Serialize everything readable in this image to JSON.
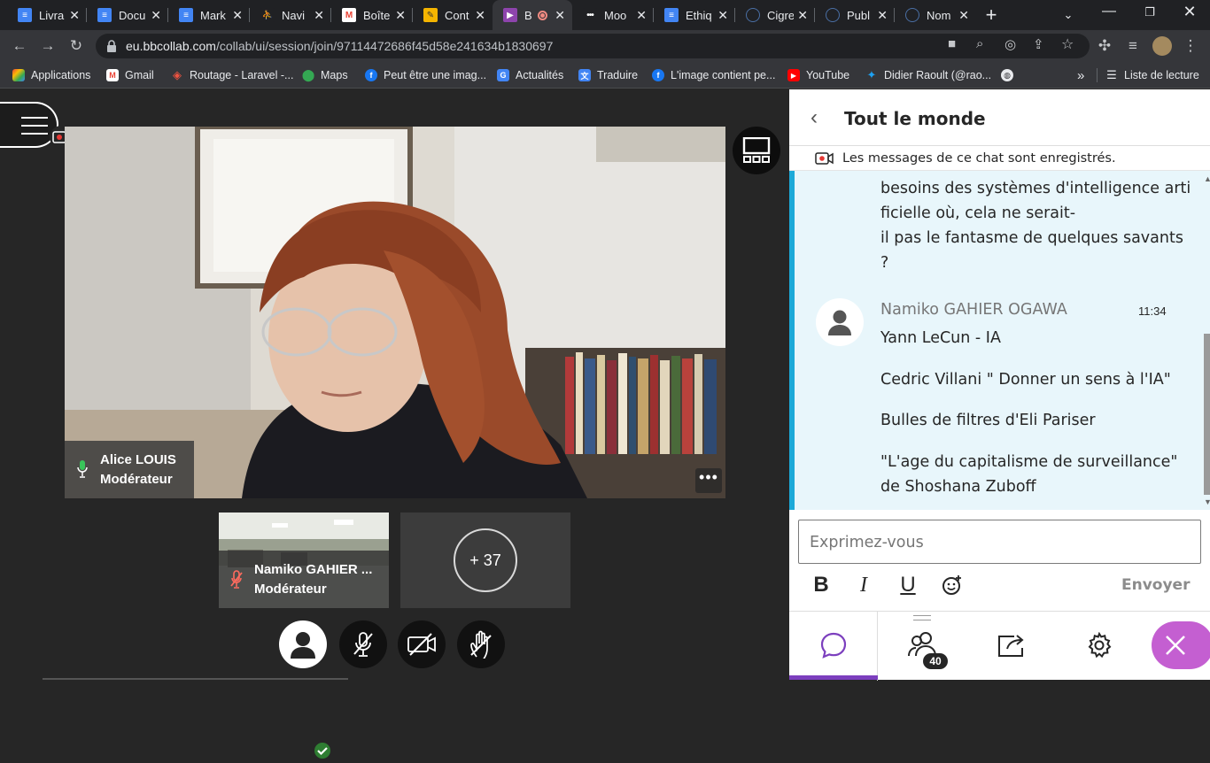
{
  "browser": {
    "tabs": [
      {
        "title": "Livra",
        "icon": "docs-icon"
      },
      {
        "title": "Docu",
        "icon": "docs-icon"
      },
      {
        "title": "Mark",
        "icon": "docs-icon"
      },
      {
        "title": "Navi",
        "icon": "figure-icon"
      },
      {
        "title": "Boîte",
        "icon": "gmail-icon"
      },
      {
        "title": "Cont",
        "icon": "contents-icon"
      },
      {
        "title": "B",
        "icon": "blackboard-icon"
      },
      {
        "title": "Moo",
        "icon": "dots-icon"
      },
      {
        "title": "Ethiq",
        "icon": "docs-icon"
      },
      {
        "title": "Cigre",
        "icon": "globe-icon"
      },
      {
        "title": "Publ",
        "icon": "globe-icon"
      },
      {
        "title": "Nom",
        "icon": "globe-icon"
      }
    ],
    "new_tab": "+",
    "url_domain": "eu.bbcollab.com",
    "url_path": "/collab/ui/session/join/97114472686f45d58e241634b1830697",
    "bookmarks": [
      "Applications",
      "Gmail",
      "Routage - Laravel -...",
      "Maps",
      "Peut être une imag...",
      "Actualités",
      "Traduire",
      "L'image contient pe...",
      "YouTube",
      "Didier Raoult (@rao..."
    ],
    "more_bookmarks": "»",
    "reading_list": "Liste de lecture"
  },
  "session": {
    "main_speaker": {
      "name": "Alice LOUIS",
      "role": "Modérateur"
    },
    "thumbnail": {
      "name": "Namiko GAHIER ...",
      "role": "Modérateur"
    },
    "more_participants": "+ 37",
    "more_options": "•••"
  },
  "panel": {
    "title": "Tout le monde",
    "recording_notice": "Les messages de ce chat sont enregistrés.",
    "prev_message_lines": [
      "besoins des systèmes d'intelligence arti",
      "ficielle où, cela ne serait-",
      "il pas le fantasme de quelques savants",
      "?"
    ],
    "message": {
      "author": "Namiko GAHIER OGAWA",
      "time": "11:34",
      "lines": [
        "Yann LeCun - IA",
        "Cedric Villani \" Donner un sens à l'IA\"",
        "Bulles de filtres d'Eli Pariser",
        "\"L'age du capitalisme de surveillance\"",
        "de Shoshana Zuboff"
      ]
    },
    "compose_placeholder": "Exprimez-vous",
    "format": {
      "bold": "B",
      "italic": "I",
      "underline": "U"
    },
    "send_label": "Envoyer",
    "participant_count": "40"
  },
  "colors": {
    "accent": "#7c3fbe",
    "chat_highlight": "#1ca9d8",
    "close": "#c45fd1"
  }
}
